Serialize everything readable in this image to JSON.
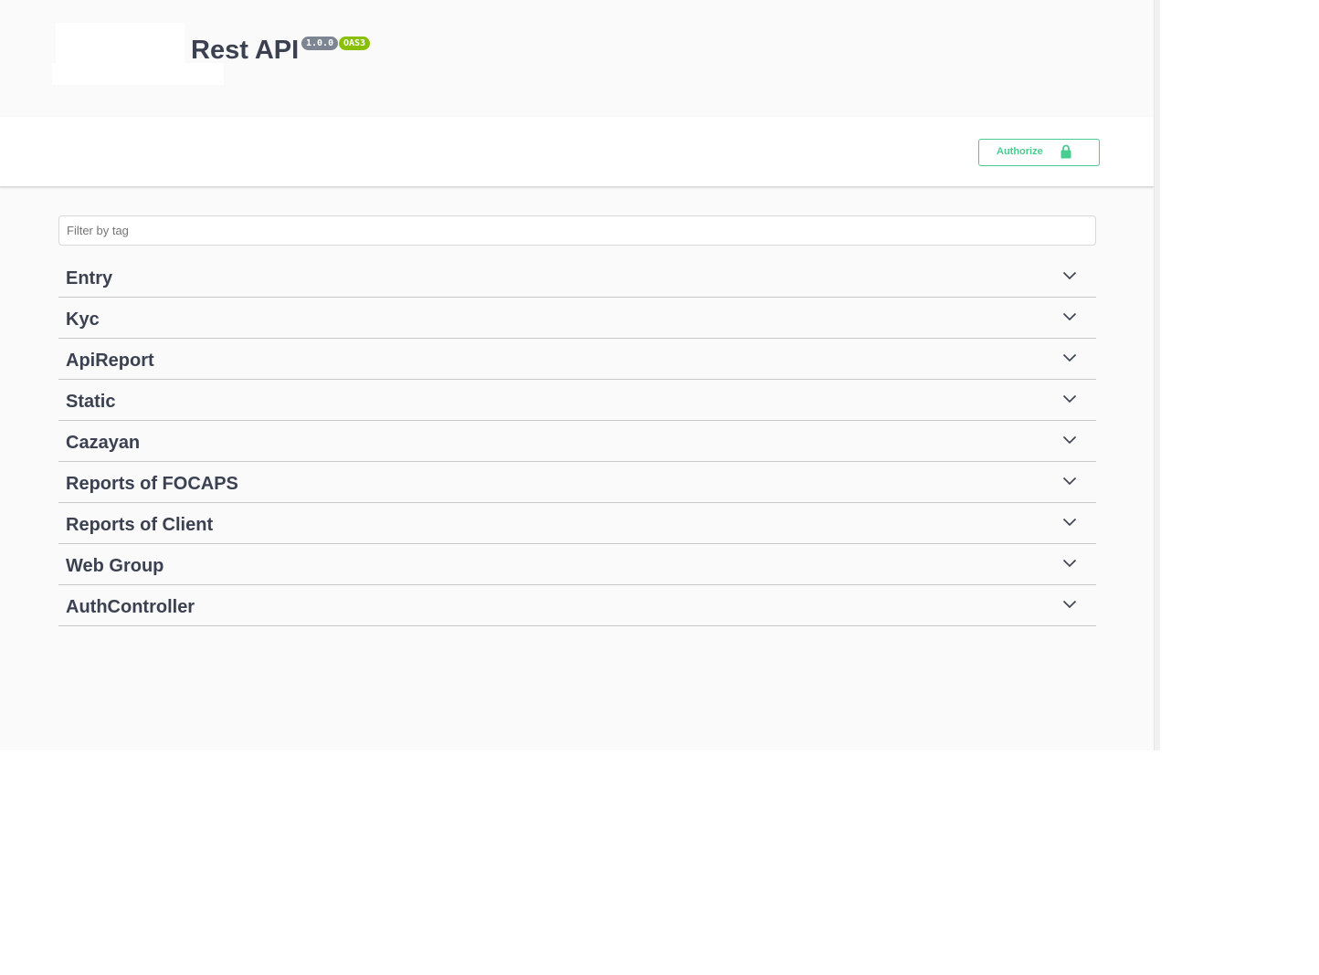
{
  "info": {
    "title": "Rest API",
    "version": "1.0.0",
    "oas_badge": "OAS3"
  },
  "scheme": {
    "authorize_label": "Authorize"
  },
  "filter": {
    "placeholder": "Filter by tag",
    "value": ""
  },
  "tags": [
    {
      "name": "Entry"
    },
    {
      "name": "Kyc"
    },
    {
      "name": "ApiReport"
    },
    {
      "name": "Static"
    },
    {
      "name": "Cazayan"
    },
    {
      "name": "Reports of FOCAPS"
    },
    {
      "name": "Reports of Client"
    },
    {
      "name": "Web Group"
    },
    {
      "name": "AuthController"
    }
  ],
  "colors": {
    "text": "#3b4151",
    "authorize_green": "#49cc90",
    "version_badge": "#7d8492",
    "oas_badge": "#89bf04",
    "background": "#fafafa"
  },
  "icons": {
    "authorize": "lock-icon",
    "tag_toggle": "chevron-down-icon"
  }
}
